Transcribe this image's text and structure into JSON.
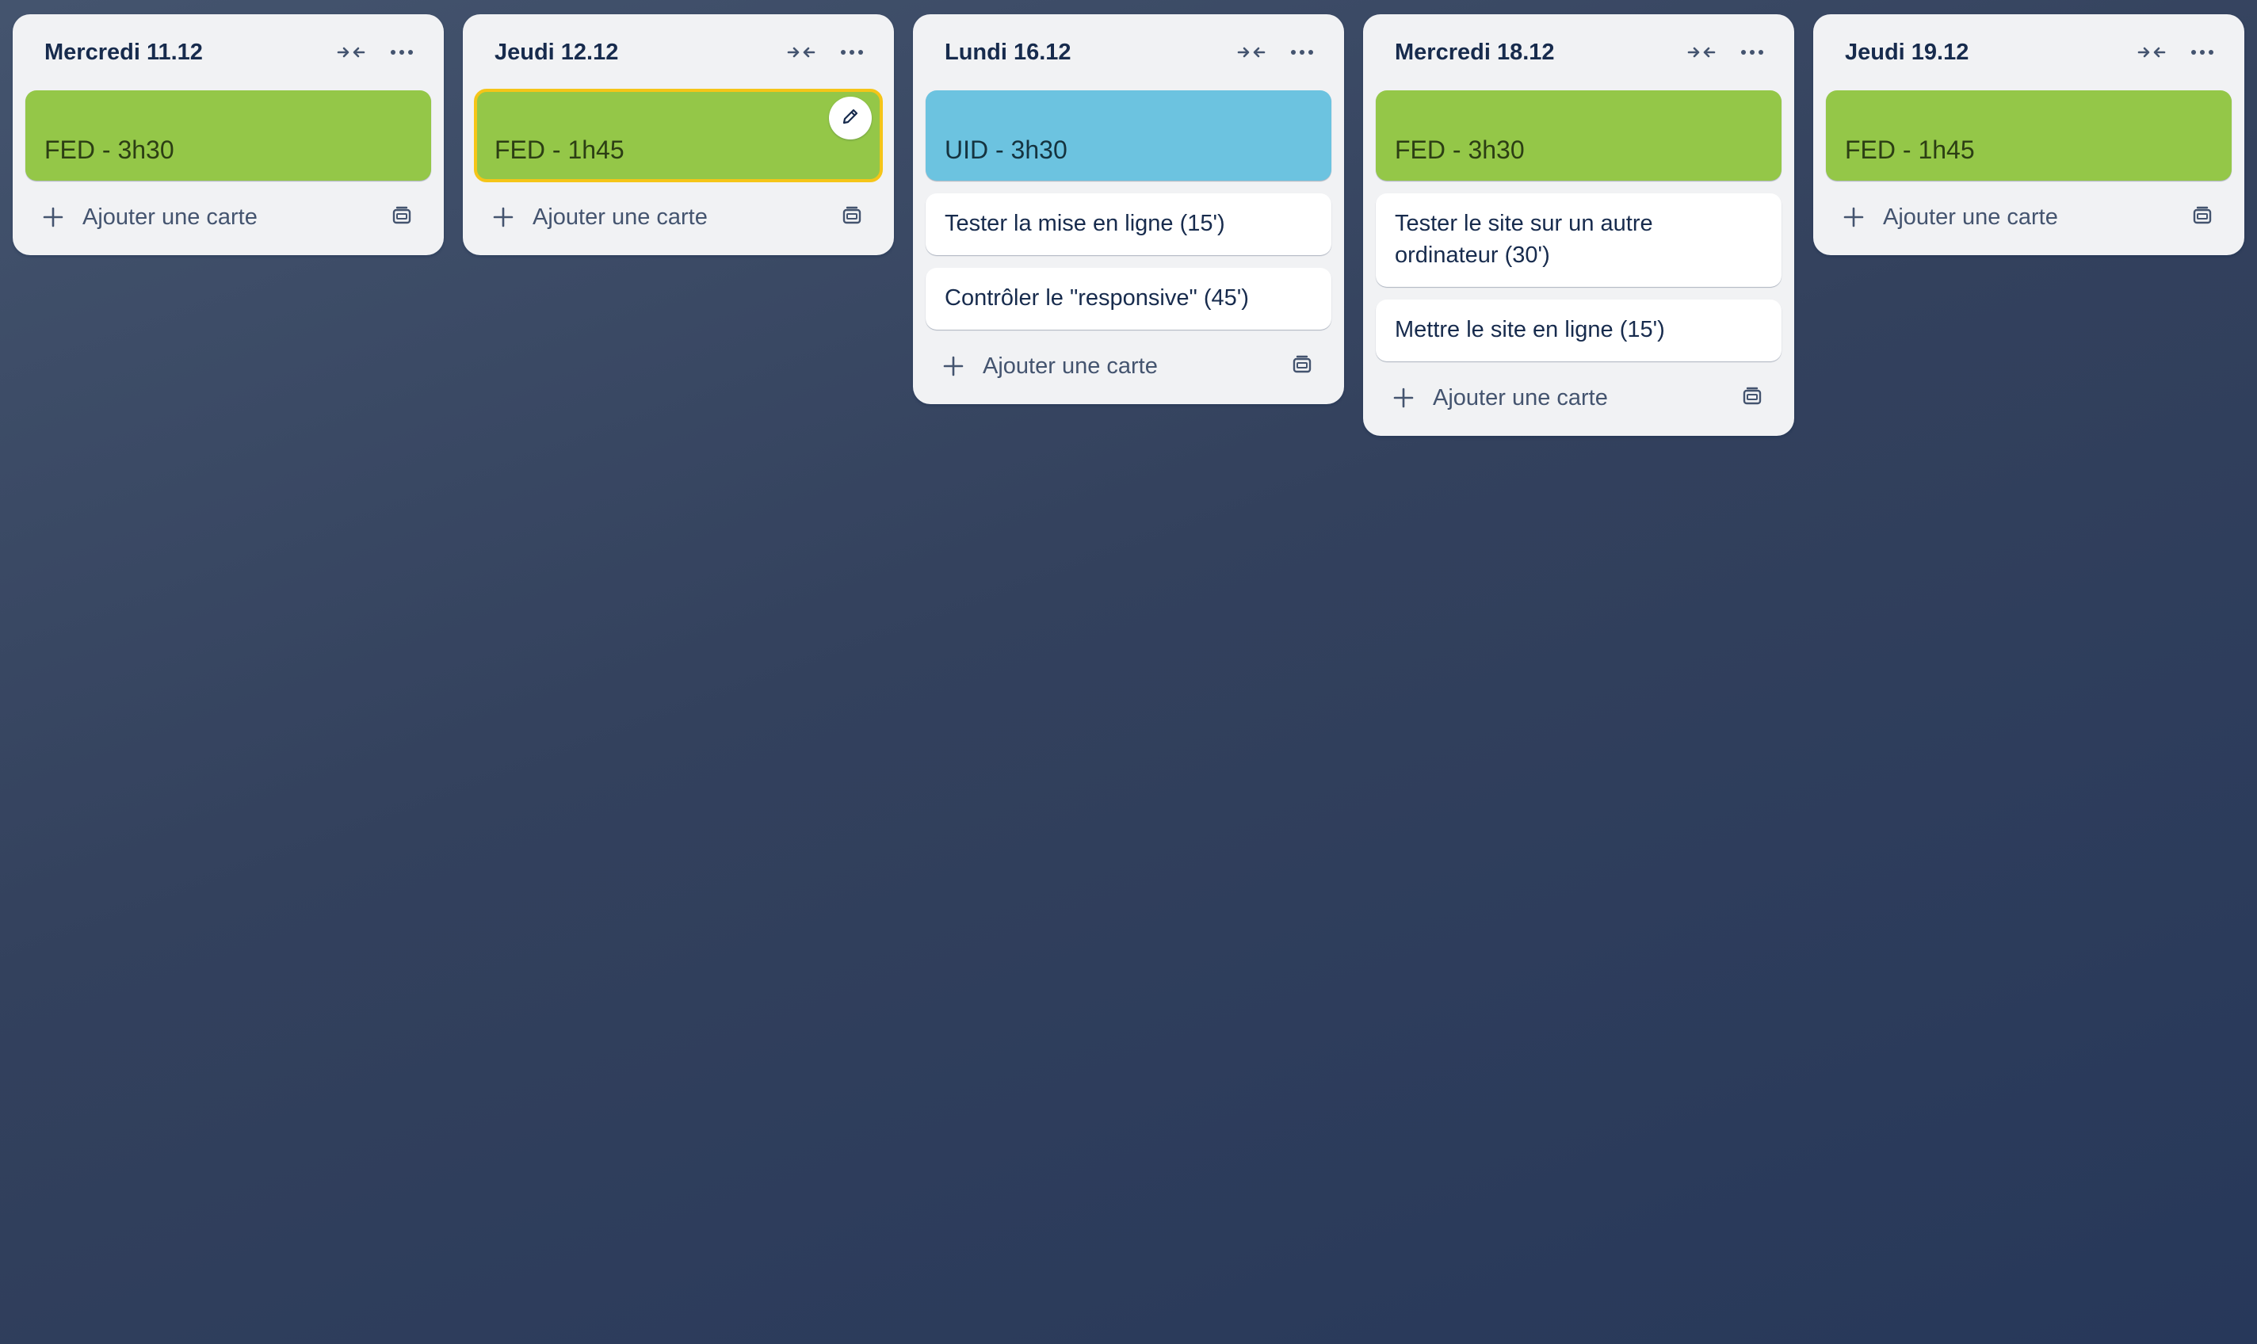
{
  "colors": {
    "list_background": "#f1f2f4",
    "label_green": "#94c748",
    "label_blue": "#6cc3e0",
    "selected_outline": "#f5c518",
    "board_background": "#33415d"
  },
  "lists": [
    {
      "title": "Mercredi 11.12",
      "cards": [
        {
          "text": "FED - 3h30",
          "type": "label",
          "color": "green"
        }
      ],
      "add_card_label": "Ajouter une carte"
    },
    {
      "title": "Jeudi 12.12",
      "cards": [
        {
          "text": "FED - 1h45",
          "type": "label",
          "color": "green",
          "selected": true,
          "edit_icon": "pencil-icon"
        }
      ],
      "add_card_label": "Ajouter une carte"
    },
    {
      "title": "Lundi 16.12",
      "cards": [
        {
          "text": "UID - 3h30",
          "type": "label",
          "color": "blue"
        },
        {
          "text": "Tester la mise en ligne (15')",
          "type": "task"
        },
        {
          "text": "Contrôler le \"responsive\" (45')",
          "type": "task"
        }
      ],
      "add_card_label": "Ajouter une carte"
    },
    {
      "title": "Mercredi 18.12",
      "cards": [
        {
          "text": "FED - 3h30",
          "type": "label",
          "color": "green"
        },
        {
          "text": "Tester le site sur un autre ordinateur (30')",
          "type": "task"
        },
        {
          "text": "Mettre le site en ligne (15')",
          "type": "task"
        }
      ],
      "add_card_label": "Ajouter une carte"
    },
    {
      "title": "Jeudi 19.12",
      "cards": [
        {
          "text": "FED - 1h45",
          "type": "label",
          "color": "green"
        }
      ],
      "add_card_label": "Ajouter une carte"
    }
  ],
  "icons": {
    "collapse": "collapse-arrows-icon",
    "menu": "more-dots-icon",
    "add": "plus-icon",
    "template": "card-template-icon",
    "edit": "pencil-icon"
  }
}
